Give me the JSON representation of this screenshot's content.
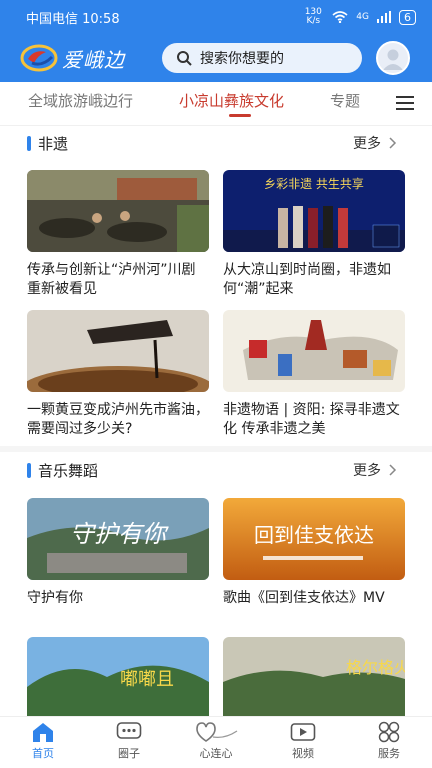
{
  "status_bar": {
    "carrier_time": "中国电信 10:58",
    "network_speed": "130 K/s",
    "signal": "4G",
    "battery": "6"
  },
  "header": {
    "logo_text": "爱峨边",
    "logo_small": "峨边",
    "search_placeholder": "搜索你想要的"
  },
  "tabs": [
    {
      "label": "全域旅游峨边行"
    },
    {
      "label": "小凉山彝族文化"
    },
    {
      "label": "专题"
    }
  ],
  "sections": [
    {
      "title": "非遗",
      "more": "更多",
      "cards": [
        {
          "title": "传承与创新让“泸州河”川剧重新被看见"
        },
        {
          "title": "从大凉山到时尚圈，非遗如何“潮”起来",
          "overlay": "乡彩非遗  共生共享"
        },
        {
          "title": "一颗黄豆变成泸州先市酱油，需要闯过多少关?"
        },
        {
          "title": "非遗物语 | 资阳: 探寻非遗文化 传承非遗之美"
        }
      ]
    },
    {
      "title": "音乐舞蹈",
      "more": "更多",
      "cards": [
        {
          "title": "守护有你",
          "overlay": "守护有你"
        },
        {
          "title": "歌曲《回到佳支依达》MV",
          "overlay": "回到佳支依达"
        },
        {
          "title": "",
          "overlay": "嘟嘟且"
        },
        {
          "title": "",
          "overlay": "格尔格火"
        }
      ]
    }
  ],
  "bottom_nav": [
    {
      "label": "首页",
      "icon": "home-icon"
    },
    {
      "label": "圈子",
      "icon": "chat-icon"
    },
    {
      "label": "心连心",
      "icon": "heart-icon"
    },
    {
      "label": "视频",
      "icon": "video-icon"
    },
    {
      "label": "服务",
      "icon": "services-icon"
    }
  ],
  "colors": {
    "brand_blue": "#2f83ea",
    "active_tab_red": "#c83b2e"
  }
}
